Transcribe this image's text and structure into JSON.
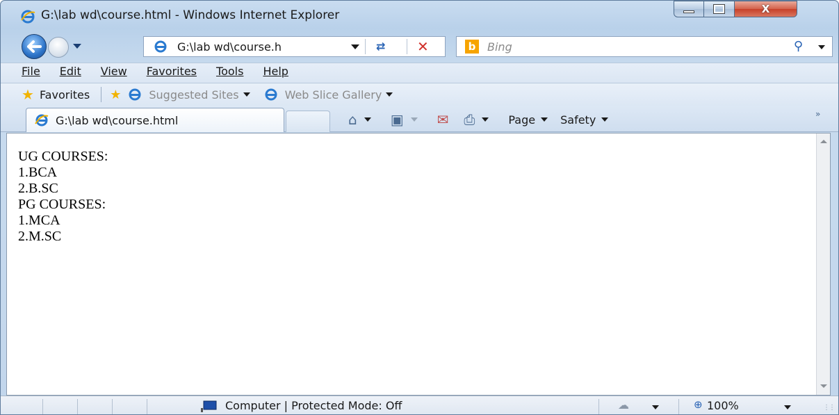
{
  "window": {
    "title": "G:\\lab wd\\course.html - Windows Internet Explorer",
    "close_glyph": "X"
  },
  "address": {
    "url": "G:\\lab wd\\course.h"
  },
  "search": {
    "placeholder": "Bing",
    "logo_letter": "b"
  },
  "menu": {
    "items": [
      "File",
      "Edit",
      "View",
      "Favorites",
      "Tools",
      "Help"
    ]
  },
  "favorites_bar": {
    "favorites_label": "Favorites",
    "links": [
      "Suggested Sites",
      "Web Slice Gallery"
    ]
  },
  "tab": {
    "label": "G:\\lab wd\\course.html"
  },
  "command_bar": {
    "page_label": "Page",
    "safety_label": "Safety",
    "overflow": "»"
  },
  "content": {
    "lines": [
      "UG COURSES:",
      "1.BCA",
      "2.B.SC",
      "PG COURSES:",
      "1.MCA",
      "2.M.SC"
    ]
  },
  "status": {
    "text": "Computer | Protected Mode: Off",
    "zoom": "100%"
  },
  "icons": {
    "back": "back-arrow-icon",
    "forward": "forward-arrow-icon",
    "refresh": "refresh-icon",
    "stop": "stop-icon",
    "search": "search-icon",
    "home": "home-icon",
    "feeds": "rss-feed-icon",
    "mail": "mail-icon",
    "print": "print-icon"
  },
  "colors": {
    "titlebar": "#c9dcf0",
    "close_button": "#c7412a",
    "link_grey": "#8a8a8a",
    "accent_blue": "#2a64b5"
  }
}
